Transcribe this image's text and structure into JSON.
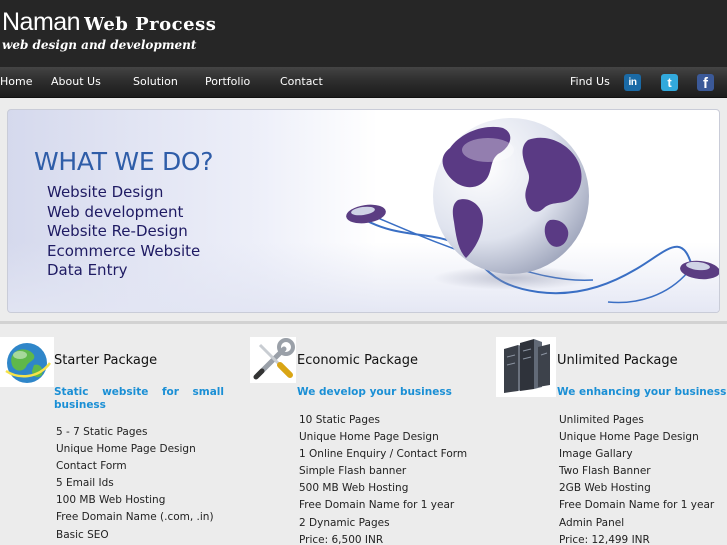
{
  "brand": {
    "name_part1": "Naman",
    "name_part2": "Web Process",
    "tagline": "web design and development"
  },
  "nav": {
    "home": "Home",
    "about": "About Us",
    "solution": "Solution",
    "portfolio": "Portfolio",
    "contact": "Contact",
    "find_us": "Find Us"
  },
  "social_icons": [
    "linkedin-icon",
    "twitter-icon",
    "facebook-icon"
  ],
  "banner": {
    "title": "WHAT WE DO?",
    "services": [
      "Website Design",
      "Web development",
      "Website Re-Design",
      "Ecommerce Website",
      "Data Entry"
    ]
  },
  "packages": [
    {
      "icon": "globe-icon",
      "title": "Starter Package",
      "subtitle": "Static website for small business",
      "items": [
        "5 - 7 Static Pages",
        "Unique Home Page Design",
        "Contact Form",
        "5 Email Ids",
        "100 MB Web Hosting",
        "Free Domain Name (.com, .in)",
        "Basic SEO"
      ]
    },
    {
      "icon": "tools-icon",
      "title": "Economic Package",
      "subtitle": "We develop your business",
      "items": [
        "10 Static Pages",
        "Unique Home Page Design",
        "1 Online Enquiry / Contact Form",
        "Simple Flash banner",
        "500 MB Web Hosting",
        "Free Domain Name for 1 year",
        "2 Dynamic Pages",
        "Price: 6,500 INR"
      ]
    },
    {
      "icon": "server-icon",
      "title": "Unlimited Package",
      "subtitle": "We enhancing your business",
      "items": [
        "Unlimited Pages",
        "Unique Home Page Design",
        "Image Gallary",
        "Two Flash Banner",
        "2GB Web Hosting",
        "Free Domain Name for 1 year",
        "Admin Panel",
        "Price: 12,499 INR"
      ]
    }
  ],
  "colors": {
    "header_bg": "#262626",
    "accent_blue": "#1a8fd5",
    "banner_title": "#2f5da8",
    "banner_text": "#1f1b63"
  }
}
